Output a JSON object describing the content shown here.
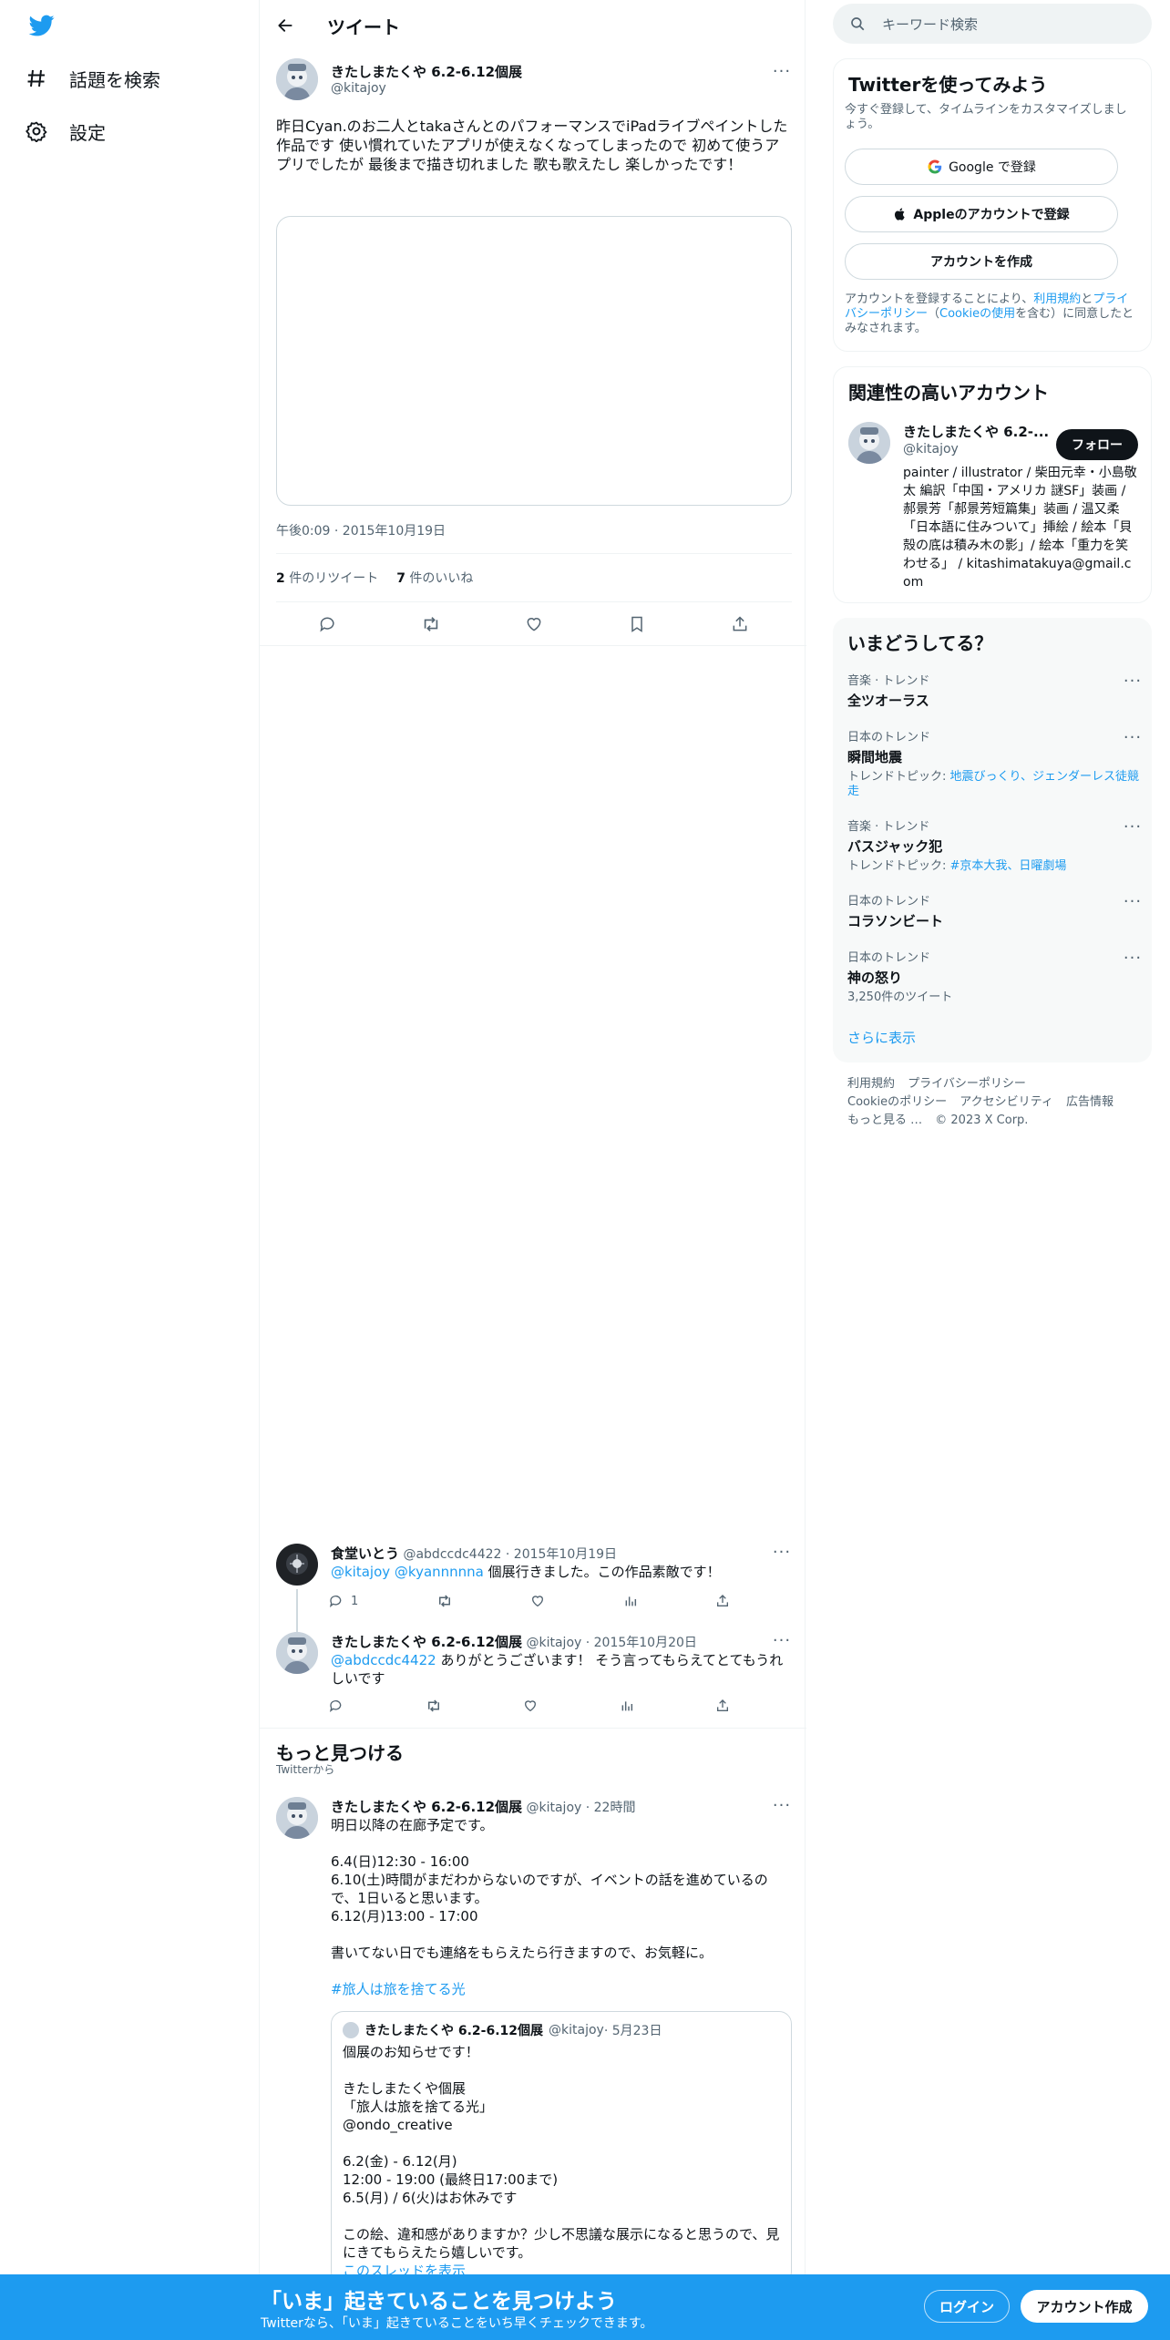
{
  "nav": {
    "explore_label": "話題を検索",
    "settings_label": "設定"
  },
  "header": {
    "title": "ツイート"
  },
  "tweet": {
    "author_name": "きたしまたくや 6.2-6.12個展",
    "author_handle": "@kitajoy",
    "more": "···",
    "text": "昨日Cyan.のお二人とtakaさんとのパフォーマンスでiPadライブペイントした作品です 使い慣れていたアプリが使えなくなってしまったので 初めて使うアプリでしたが 最後まで描き切れました 歌も歌えたし 楽しかったです！",
    "timestamp": "午後0:09 · 2015年10月19日",
    "retweets_count": "2",
    "retweets_label": " 件のリツイート",
    "likes_count": "7",
    "likes_label": " 件のいいね"
  },
  "replies": [
    {
      "name": "食堂いとう",
      "handle": "@abdccdc4422",
      "date": " · 2015年10月19日",
      "mentions": "@kitajoy @kyannnnna",
      "text": " 個展行きました。この作品素敵です！",
      "reply_count": "1"
    },
    {
      "name": "きたしまたくや 6.2-6.12個展",
      "handle": "@kitajoy",
      "date": " · 2015年10月20日",
      "mentions": "@abdccdc4422",
      "text": " ありがとうございます！ そう言ってもらえてとてもうれしいです"
    }
  ],
  "discover": {
    "title": "もっと見つける",
    "subtitle": "Twitterから",
    "tweet": {
      "name": "きたしまたくや 6.2-6.12個展",
      "handle": "@kitajoy",
      "date": " · 22時間",
      "line1": "明日以降の在廊予定です。",
      "line2": "6.4(日)12:30 - 16:00",
      "line3": "6.10(土)時間がまだわからないのですが、イベントの話を進めているので、1日いると思います。",
      "line4": "6.12(月)13:00 - 17:00",
      "line5": "書いてない日でも連絡をもらえたら行きますので、お気軽に。",
      "hashtag": "#旅人は旅を捨てる光"
    },
    "quote": {
      "name": "きたしまたくや 6.2-6.12個展",
      "handle": "@kitajoy",
      "date": " · 5月23日",
      "line1": "個展のお知らせです！",
      "line2": "きたしまたくや個展",
      "line3": "「旅人は旅を捨てる光」",
      "line4": "@ondo_creative",
      "line5": "6.2(金) - 6.12(月)",
      "line6": "12:00 - 19:00 (最終日17:00まで)",
      "line7": "6.5(月) / 6(火)はお休みです",
      "line8": "この絵、違和感がありますか？少し不思議な展示になると思うので、見にきてもらえたら嬉しいです。",
      "show_more": "このスレッドを表示"
    }
  },
  "sidebar": {
    "search_placeholder": "キーワード検索",
    "signup_card": {
      "title": "Twitterを使ってみよう",
      "subtitle": "今すぐ登録して、タイムラインをカスタマイズしましょう。",
      "google_label": "Google で登録",
      "apple_label": "Appleのアカウントで登録",
      "create_label": "アカウントを作成",
      "legal_prefix": "アカウントを登録することにより、",
      "terms_link": "利用規約",
      "and": "と",
      "privacy_link": "プライバシーポリシー",
      "cookie_prefix": "（",
      "cookie_link": "Cookieの使用",
      "legal_suffix": "を含む）に同意したとみなされます。"
    },
    "related": {
      "title": "関連性の高いアカウント",
      "name": "きたしまたくや 6.2-...",
      "handle": "@kitajoy",
      "follow_label": "フォロー",
      "bio": "painter / illustrator / 柴田元幸・小島敬太 編訳「中国・アメリカ 謎SF」装画 / 郝景芳「郝景芳短篇集」装画 / 温又柔「日本語に住みついて」挿絵 / 絵本「貝殻の底は積み木の影」/ 絵本「重力を笑わせる」 / kitashimatakuya@gmail.com"
    },
    "trends": {
      "title": "いまどうしてる？",
      "items": [
        {
          "category": "音楽 · トレンド",
          "name": "全ツオーラス",
          "sub": ""
        },
        {
          "category": "日本のトレンド",
          "name": "瞬間地震",
          "sub_prefix": "トレンドトピック: ",
          "sub_links": "地震びっくり、ジェンダーレス徒競走"
        },
        {
          "category": "音楽 · トレンド",
          "name": "バスジャック犯",
          "sub_prefix": "トレンドトピック: ",
          "sub_links": "#京本大我、日曜劇場"
        },
        {
          "category": "日本のトレンド",
          "name": "コラソンビート",
          "sub": ""
        },
        {
          "category": "日本のトレンド",
          "name": "神の怒り",
          "sub": "3,250件のツイート"
        }
      ],
      "show_more": "さらに表示"
    },
    "footer": {
      "terms": "利用規約",
      "privacy": "プライバシーポリシー",
      "cookie": "Cookieのポリシー",
      "accessibility": "アクセシビリティ",
      "ads": "広告情報",
      "more": "もっと見る …",
      "copyright": "© 2023 X Corp."
    }
  },
  "bottom_bar": {
    "title": "「いま」起きていることを見つけよう",
    "subtitle": "Twitterなら、「いま」起きていることをいち早くチェックできます。",
    "login_label": "ログイン",
    "signup_label": "アカウント作成"
  },
  "colors": {
    "brand": "#1d9bf0",
    "text": "#0f1419",
    "muted": "#536471"
  }
}
